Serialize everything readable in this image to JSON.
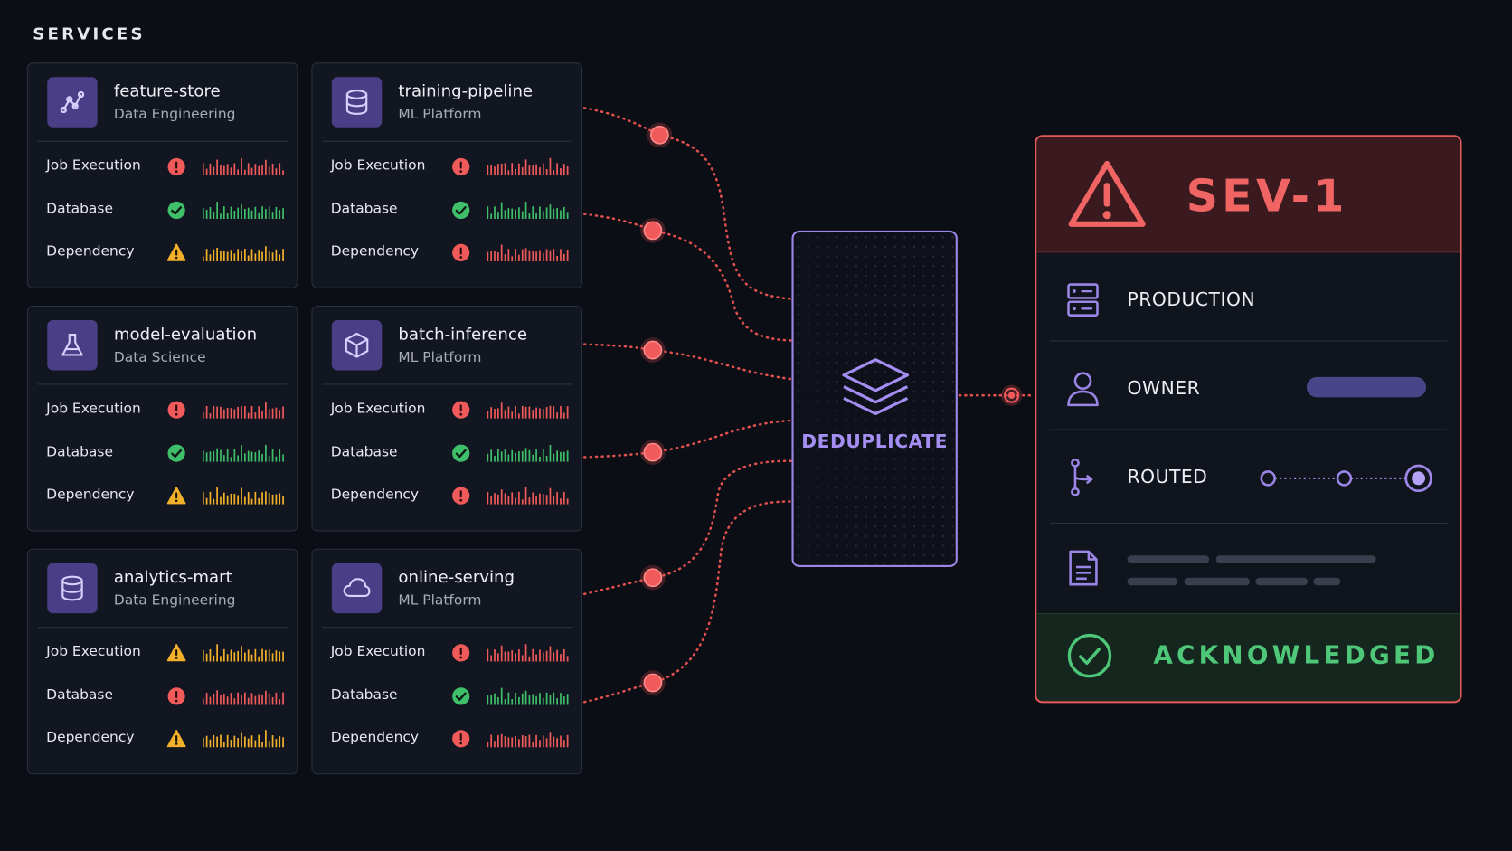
{
  "section_title": "SERVICES",
  "status_colors": {
    "error": "#f05a5a",
    "ok": "#3fbf6a",
    "warning": "#f2b02b"
  },
  "services": [
    {
      "name": "feature-store",
      "team": "Data Engineering",
      "icon": "graph-icon",
      "checks": [
        {
          "label": "Job Execution",
          "status": "error"
        },
        {
          "label": "Database",
          "status": "ok"
        },
        {
          "label": "Dependency",
          "status": "warning"
        }
      ]
    },
    {
      "name": "training-pipeline",
      "team": "ML Platform",
      "icon": "database-icon",
      "checks": [
        {
          "label": "Job Execution",
          "status": "error"
        },
        {
          "label": "Database",
          "status": "ok"
        },
        {
          "label": "Dependency",
          "status": "error"
        }
      ]
    },
    {
      "name": "model-evaluation",
      "team": "Data Science",
      "icon": "flask-icon",
      "checks": [
        {
          "label": "Job Execution",
          "status": "error"
        },
        {
          "label": "Database",
          "status": "ok"
        },
        {
          "label": "Dependency",
          "status": "warning"
        }
      ]
    },
    {
      "name": "batch-inference",
      "team": "ML Platform",
      "icon": "cube-icon",
      "checks": [
        {
          "label": "Job Execution",
          "status": "error"
        },
        {
          "label": "Database",
          "status": "ok"
        },
        {
          "label": "Dependency",
          "status": "error"
        }
      ]
    },
    {
      "name": "analytics-mart",
      "team": "Data Engineering",
      "icon": "database-icon",
      "checks": [
        {
          "label": "Job Execution",
          "status": "warning"
        },
        {
          "label": "Database",
          "status": "error"
        },
        {
          "label": "Dependency",
          "status": "warning"
        }
      ]
    },
    {
      "name": "online-serving",
      "team": "ML Platform",
      "icon": "cloud-icon",
      "checks": [
        {
          "label": "Job Execution",
          "status": "error"
        },
        {
          "label": "Database",
          "status": "ok"
        },
        {
          "label": "Dependency",
          "status": "error"
        }
      ]
    }
  ],
  "dedup": {
    "label": "DEDUPLICATE",
    "icon": "layers-icon"
  },
  "incident": {
    "severity": "SEV-1",
    "icon": "warning-triangle-icon",
    "rows": [
      {
        "label": "PRODUCTION",
        "icon": "server-icon"
      },
      {
        "label": "OWNER",
        "icon": "user-icon"
      },
      {
        "label": "ROUTED",
        "icon": "branch-icon"
      }
    ],
    "notes_icon": "document-icon",
    "status": "ACKNOWLEDGED",
    "status_icon": "check-circle-icon",
    "accent": "#f06464",
    "ack_color": "#4ec778"
  }
}
